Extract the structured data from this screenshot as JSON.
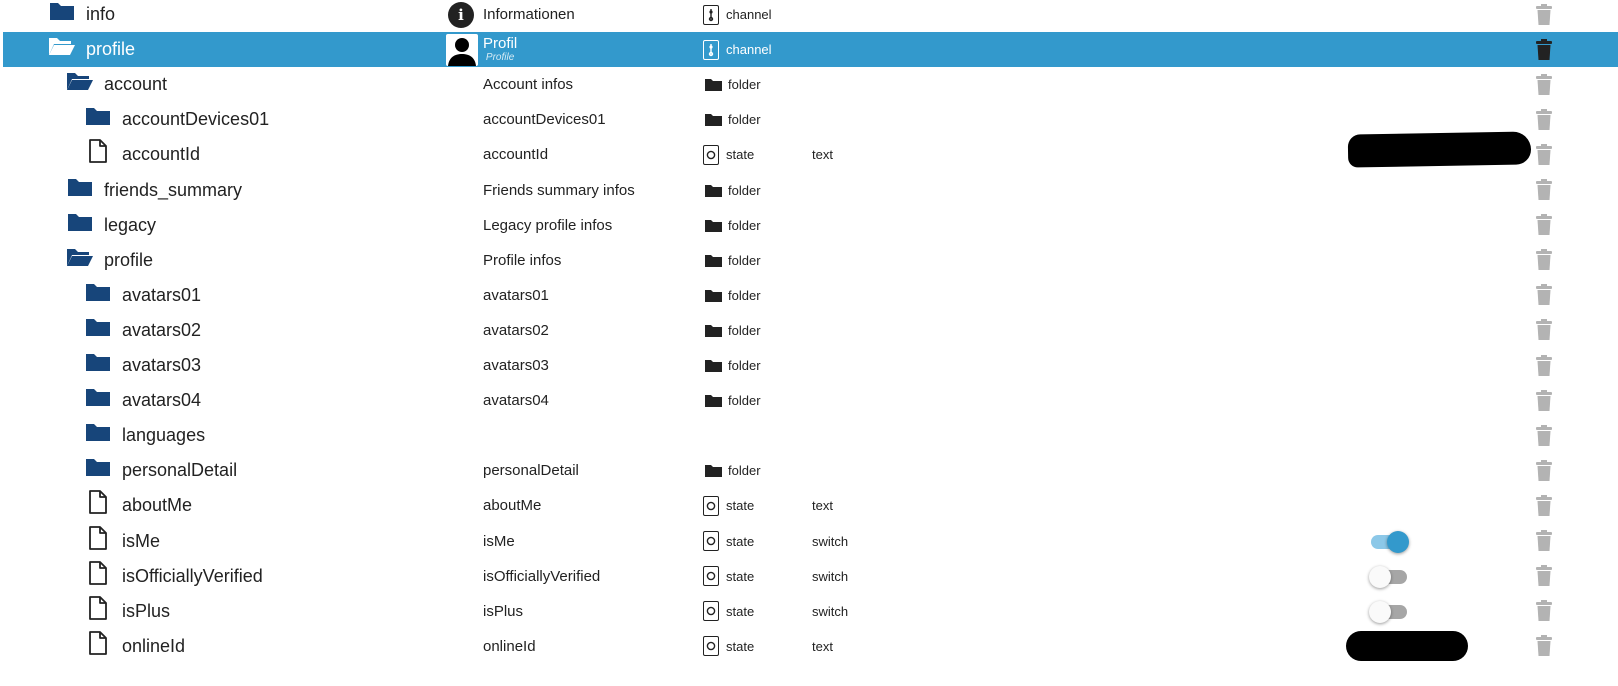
{
  "colors": {
    "selected": "#3399cc",
    "folder": "#17457a",
    "toggle_on": "#3399cc",
    "toggle_off": "#a6a6a6",
    "trash": "#b3b3b3"
  },
  "rows": [
    {
      "name": "info",
      "desc": "Informationen",
      "type": "channel",
      "role": "",
      "icon": "folder-icon",
      "indent": 0,
      "kind": "closed"
    },
    {
      "name": "profile",
      "desc": "Profil",
      "desc_sub": "Profile",
      "type": "channel",
      "role": "",
      "icon": "folder-open-icon",
      "indent": 0,
      "kind": "open",
      "selected": true
    },
    {
      "name": "account",
      "desc": "Account infos",
      "type": "folder",
      "role": "",
      "icon": "folder-open-icon",
      "indent": 1,
      "kind": "open"
    },
    {
      "name": "accountDevices01",
      "desc": "accountDevices01",
      "type": "folder",
      "role": "",
      "icon": "folder-icon",
      "indent": 2,
      "kind": "closed"
    },
    {
      "name": "accountId",
      "desc": "accountId",
      "type": "state",
      "role": "text",
      "icon": "file-icon",
      "indent": 2,
      "kind": "file"
    },
    {
      "name": "friends_summary",
      "desc": "Friends summary infos",
      "type": "folder",
      "role": "",
      "icon": "folder-icon",
      "indent": 1,
      "kind": "closed"
    },
    {
      "name": "legacy",
      "desc": "Legacy profile infos",
      "type": "folder",
      "role": "",
      "icon": "folder-icon",
      "indent": 1,
      "kind": "closed"
    },
    {
      "name": "profile",
      "desc": "Profile infos",
      "type": "folder",
      "role": "",
      "icon": "folder-open-icon",
      "indent": 1,
      "kind": "open"
    },
    {
      "name": "avatars01",
      "desc": "avatars01",
      "type": "folder",
      "role": "",
      "icon": "folder-icon",
      "indent": 2,
      "kind": "closed"
    },
    {
      "name": "avatars02",
      "desc": "avatars02",
      "type": "folder",
      "role": "",
      "icon": "folder-icon",
      "indent": 2,
      "kind": "closed"
    },
    {
      "name": "avatars03",
      "desc": "avatars03",
      "type": "folder",
      "role": "",
      "icon": "folder-icon",
      "indent": 2,
      "kind": "closed"
    },
    {
      "name": "avatars04",
      "desc": "avatars04",
      "type": "folder",
      "role": "",
      "icon": "folder-icon",
      "indent": 2,
      "kind": "closed"
    },
    {
      "name": "languages",
      "desc": "",
      "type": "",
      "role": "",
      "icon": "folder-icon",
      "indent": 2,
      "kind": "closed"
    },
    {
      "name": "personalDetail",
      "desc": "personalDetail",
      "type": "folder",
      "role": "",
      "icon": "folder-icon",
      "indent": 2,
      "kind": "closed"
    },
    {
      "name": "aboutMe",
      "desc": "aboutMe",
      "type": "state",
      "role": "text",
      "icon": "file-icon",
      "indent": 2,
      "kind": "file"
    },
    {
      "name": "isMe",
      "desc": "isMe",
      "type": "state",
      "role": "switch",
      "icon": "file-icon",
      "indent": 2,
      "kind": "file",
      "toggle": true
    },
    {
      "name": "isOfficiallyVerified",
      "desc": "isOfficiallyVerified",
      "type": "state",
      "role": "switch",
      "icon": "file-icon",
      "indent": 2,
      "kind": "file",
      "toggle": false
    },
    {
      "name": "isPlus",
      "desc": "isPlus",
      "type": "state",
      "role": "switch",
      "icon": "file-icon",
      "indent": 2,
      "kind": "file",
      "toggle": false
    },
    {
      "name": "onlineId",
      "desc": "onlineId",
      "type": "state",
      "role": "text",
      "icon": "file-icon",
      "indent": 2,
      "kind": "file"
    }
  ]
}
